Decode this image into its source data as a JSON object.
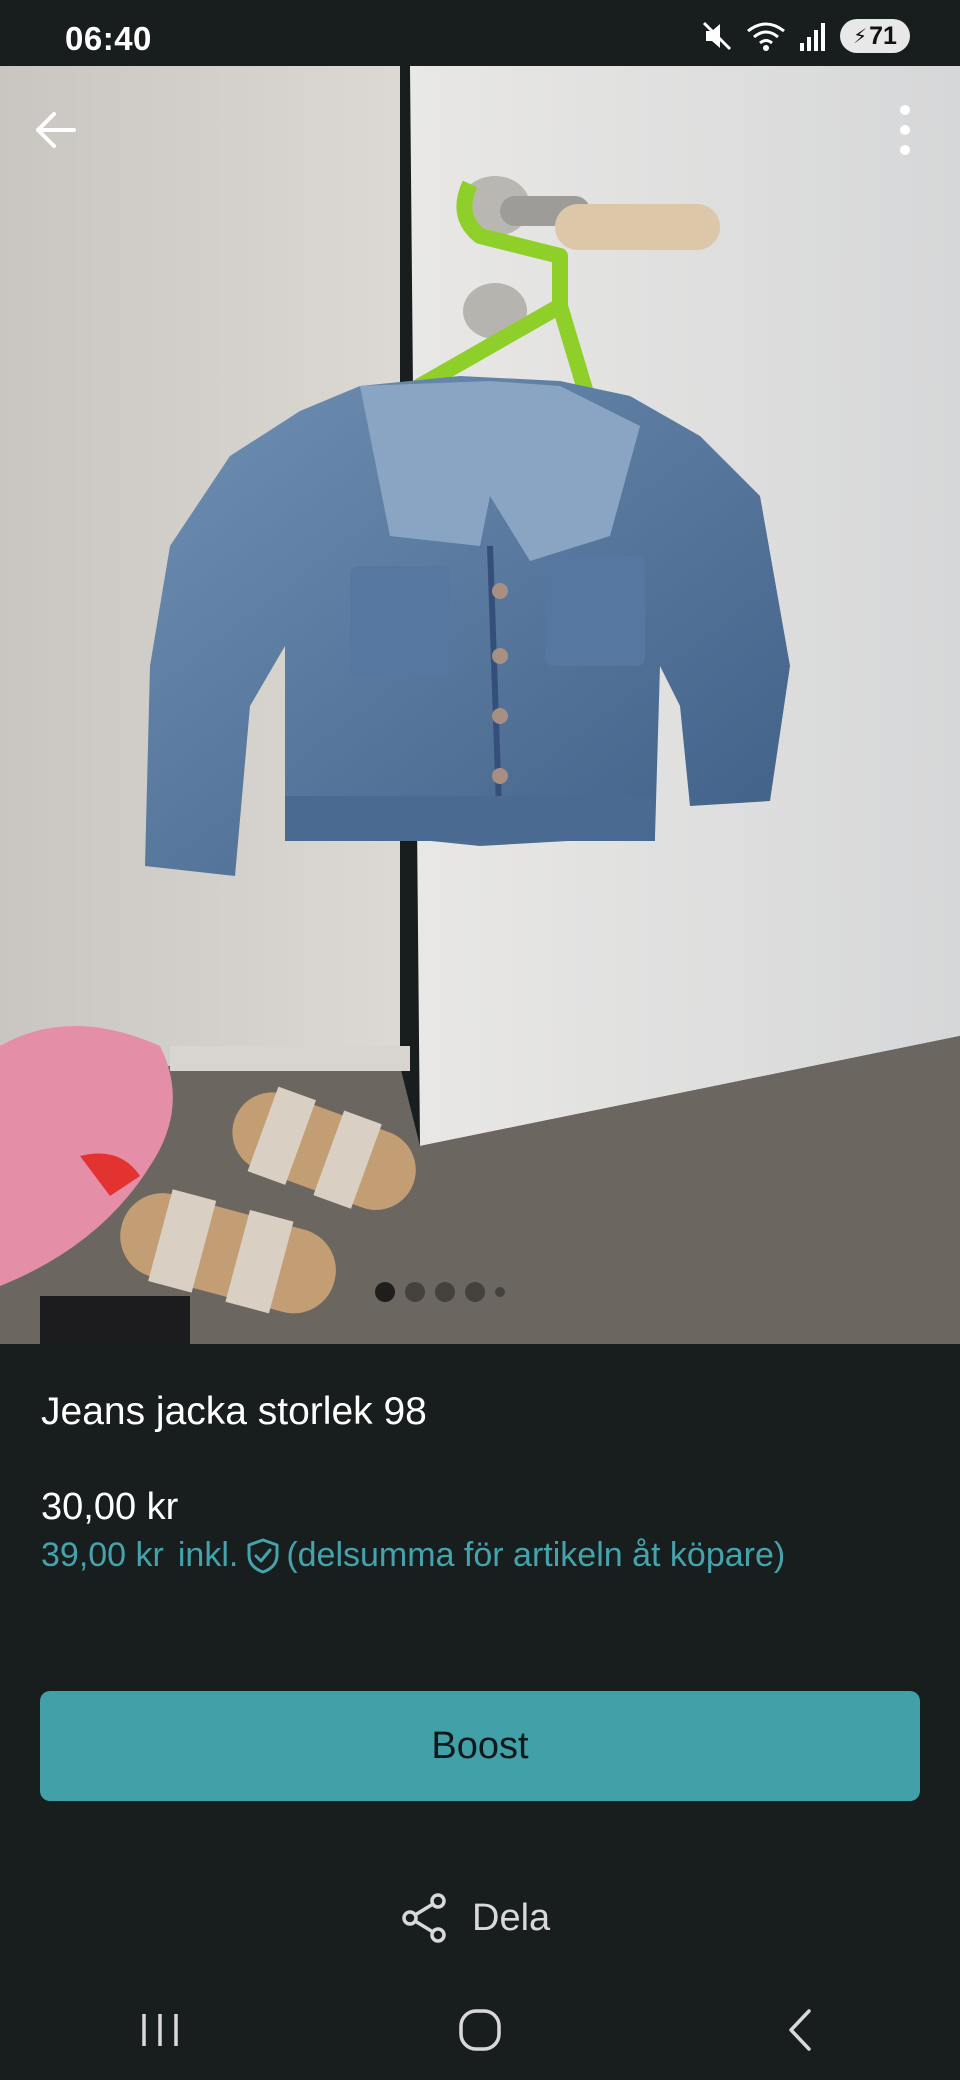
{
  "status_bar": {
    "time": "06:40",
    "battery": "71",
    "icons": [
      "mute-icon",
      "wifi-icon",
      "signal-icon",
      "battery-icon"
    ]
  },
  "listing": {
    "photo_count": 4,
    "active_photo": 1,
    "title": "Jeans jacka storlek 98",
    "price": "30,00 kr",
    "price_incl": "39,00 kr",
    "incl_label": "inkl.",
    "incl_note": "(delsumma för artikeln åt köpare)"
  },
  "actions": {
    "boost_label": "Boost",
    "share_label": "Dela"
  },
  "colors": {
    "background": "#181d1e",
    "accent": "#42a0a9",
    "accent_text": "#44a3ac"
  }
}
